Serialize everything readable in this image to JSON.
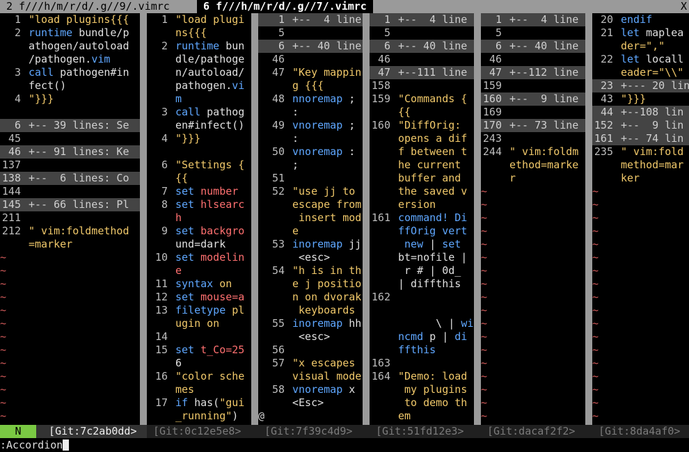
{
  "tabs": [
    {
      "label": " 2 f///h/m/r/d/.g//9/.vimrc ",
      "active": false
    },
    {
      "label": " 6 f///h/m/r/d/.g//7/.vimrc ",
      "active": true
    }
  ],
  "tab_close": "X",
  "panes": [
    {
      "numw": 30,
      "rows": [
        {
          "n": "1",
          "t": "\"load plugins{{{",
          "c": "cmt"
        },
        {
          "n": "2",
          "t": "runtime bundle/p",
          "c": "rt"
        },
        {
          "n": "",
          "t": "athogen/autoload"
        },
        {
          "n": "",
          "t": "/pathogen.vim",
          "c": "vimext"
        },
        {
          "n": "3",
          "t": "call pathogen#in",
          "c": "call"
        },
        {
          "n": "",
          "t": "fect()"
        },
        {
          "n": "4",
          "t": "\"}}}",
          "c": "cmt"
        },
        {
          "n": "",
          "t": ""
        },
        {
          "n": "6",
          "t": "+-- 39 lines: Se",
          "fold": true
        },
        {
          "n": "45",
          "t": ""
        },
        {
          "n": "46",
          "t": "+-- 91 lines: Ke",
          "fold": true
        },
        {
          "n": "137",
          "t": ""
        },
        {
          "n": "138",
          "t": "+--  6 lines: Co",
          "fold": true
        },
        {
          "n": "144",
          "t": ""
        },
        {
          "n": "145",
          "t": "+-- 66 lines: Pl",
          "fold": true
        },
        {
          "n": "211",
          "t": ""
        },
        {
          "n": "212",
          "t": "\" vim:foldmethod",
          "c": "cmt"
        },
        {
          "n": "",
          "t": "=marker",
          "c": "cmt"
        },
        {
          "n": "~",
          "tilde": true
        },
        {
          "n": "~",
          "tilde": true
        },
        {
          "n": "~",
          "tilde": true
        },
        {
          "n": "~",
          "tilde": true
        },
        {
          "n": "~",
          "tilde": true
        },
        {
          "n": "~",
          "tilde": true
        },
        {
          "n": "~",
          "tilde": true
        },
        {
          "n": "~",
          "tilde": true
        },
        {
          "n": "~",
          "tilde": true
        },
        {
          "n": "~",
          "tilde": true
        },
        {
          "n": "~",
          "tilde": true
        },
        {
          "n": "~",
          "tilde": true
        },
        {
          "n": "~",
          "tilde": true
        }
      ]
    },
    {
      "numw": 30,
      "rows": [
        {
          "n": "1",
          "t": "\"load plugi",
          "c": "cmt"
        },
        {
          "n": "",
          "t": "ns{{{",
          "c": "cmt"
        },
        {
          "n": "2",
          "t": "runtime bun",
          "c": "rt"
        },
        {
          "n": "",
          "t": "dle/pathoge"
        },
        {
          "n": "",
          "t": "n/autoload/"
        },
        {
          "n": "",
          "t": "pathogen.vi",
          "c": "vimext"
        },
        {
          "n": "",
          "t": "m",
          "c": "kw"
        },
        {
          "n": "3",
          "t": "call pathog",
          "c": "call"
        },
        {
          "n": "",
          "t": "en#infect()"
        },
        {
          "n": "4",
          "t": "\"}}}",
          "c": "cmt"
        },
        {
          "n": "",
          "t": ""
        },
        {
          "n": "6",
          "t": "\"Settings {",
          "c": "cmt"
        },
        {
          "n": "",
          "t": "{{",
          "c": "cmt"
        },
        {
          "n": "7",
          "t": "set number",
          "c": "setkw"
        },
        {
          "n": "8",
          "t": "set hlsearc",
          "c": "setkw"
        },
        {
          "n": "",
          "t": "h",
          "c": "setkw2"
        },
        {
          "n": "9",
          "t": "set backgro",
          "c": "setkw"
        },
        {
          "n": "",
          "t": "und=dark"
        },
        {
          "n": "10",
          "t": "set modelin",
          "c": "setkw"
        },
        {
          "n": "",
          "t": "e",
          "c": "setkw2"
        },
        {
          "n": "11",
          "t": "syntax on",
          "c": "syn"
        },
        {
          "n": "12",
          "t": "set mouse=a",
          "c": "setkw"
        },
        {
          "n": "13",
          "t": "filetype pl",
          "c": "ft"
        },
        {
          "n": "",
          "t": "ugin on",
          "c": "ft2"
        },
        {
          "n": "14",
          "t": ""
        },
        {
          "n": "15",
          "t": "set t_Co=25",
          "c": "setkw"
        },
        {
          "n": "",
          "t": "6"
        },
        {
          "n": "16",
          "t": "\"color sche",
          "c": "cmt"
        },
        {
          "n": "",
          "t": "mes",
          "c": "cmt"
        },
        {
          "n": "17",
          "t": "if has(\"gui",
          "c": "ifhas"
        },
        {
          "n": "",
          "t": "_running\")",
          "c": "str2"
        }
      ]
    },
    {
      "numw": 38,
      "rows": [
        {
          "n": "1",
          "t": "+--  4 line",
          "fold": true
        },
        {
          "n": "5",
          "t": ""
        },
        {
          "n": "6",
          "t": "+-- 40 line",
          "fold": true
        },
        {
          "n": "46",
          "t": ""
        },
        {
          "n": "47",
          "t": "\"Key mappin",
          "c": "cmt"
        },
        {
          "n": "",
          "t": "g {{{",
          "c": "cmt"
        },
        {
          "n": "48",
          "t": "nnoremap ;",
          "c": "map"
        },
        {
          "n": "",
          "t": ":"
        },
        {
          "n": "49",
          "t": "vnoremap ;",
          "c": "map"
        },
        {
          "n": "",
          "t": ":"
        },
        {
          "n": "50",
          "t": "vnoremap :",
          "c": "map"
        },
        {
          "n": "",
          "t": ";"
        },
        {
          "n": "51",
          "t": ""
        },
        {
          "n": "52",
          "t": "\"use jj to",
          "c": "cmt"
        },
        {
          "n": "",
          "t": "escape from",
          "c": "cmt"
        },
        {
          "n": "",
          "t": " insert mod",
          "c": "cmt"
        },
        {
          "n": "",
          "t": "e",
          "c": "cmt"
        },
        {
          "n": "53",
          "t": "inoremap jj",
          "c": "map"
        },
        {
          "n": "",
          "t": " <esc>"
        },
        {
          "n": "54",
          "t": "\"h is in th",
          "c": "cmt"
        },
        {
          "n": "",
          "t": "e j positio",
          "c": "cmt"
        },
        {
          "n": "",
          "t": "n on dvorak",
          "c": "cmt"
        },
        {
          "n": "",
          "t": " keyboards",
          "c": "cmt"
        },
        {
          "n": "55",
          "t": "inoremap hh",
          "c": "map"
        },
        {
          "n": "",
          "t": " <esc>"
        },
        {
          "n": "56",
          "t": ""
        },
        {
          "n": "57",
          "t": "\"x escapes",
          "c": "cmt"
        },
        {
          "n": "",
          "t": "visual mode",
          "c": "cmt"
        },
        {
          "n": "58",
          "t": "vnoremap x",
          "c": "map"
        },
        {
          "n": "",
          "t": "<Esc>"
        },
        {
          "n": "@",
          "at": true
        }
      ]
    },
    {
      "numw": 30,
      "rows": [
        {
          "n": "1",
          "t": "+--  4 line",
          "fold": true
        },
        {
          "n": "5",
          "t": ""
        },
        {
          "n": "6",
          "t": "+-- 40 line",
          "fold": true
        },
        {
          "n": "46",
          "t": ""
        },
        {
          "n": "47",
          "t": "+--111 line",
          "fold": true
        },
        {
          "n": "158",
          "t": ""
        },
        {
          "n": "159",
          "t": "\"Commands {",
          "c": "cmt"
        },
        {
          "n": "",
          "t": "{{",
          "c": "cmt"
        },
        {
          "n": "160",
          "t": "\"DiffOrig:",
          "c": "cmt"
        },
        {
          "n": "",
          "t": "opens a dif",
          "c": "cmt"
        },
        {
          "n": "",
          "t": "f between t",
          "c": "cmt"
        },
        {
          "n": "",
          "t": "he current",
          "c": "cmt"
        },
        {
          "n": "",
          "t": "buffer and",
          "c": "cmt"
        },
        {
          "n": "",
          "t": "the saved v",
          "c": "cmt"
        },
        {
          "n": "",
          "t": "ersion",
          "c": "cmt"
        },
        {
          "n": "161",
          "t": "command! Di",
          "c": "cmd"
        },
        {
          "n": "",
          "t": "ffOrig vert",
          "c": "cmd2"
        },
        {
          "n": "",
          "t": " new | set",
          "c": "cmd3"
        },
        {
          "n": "",
          "t": "bt=nofile |"
        },
        {
          "n": "",
          "t": " r # | 0d_"
        },
        {
          "n": "",
          "t": "| diffthis"
        },
        {
          "n": "162",
          "t": ""
        },
        {
          "n": "",
          "t": ""
        },
        {
          "n": "",
          "t": "      \\ | wi",
          "c": "cmd4"
        },
        {
          "n": "",
          "t": "ncmd p | di",
          "c": "cmd5"
        },
        {
          "n": "",
          "t": "ffthis",
          "c": "kw"
        },
        {
          "n": "163",
          "t": ""
        },
        {
          "n": "164",
          "t": "\"Demo: load",
          "c": "cmt"
        },
        {
          "n": "",
          "t": " my plugins",
          "c": "cmt"
        },
        {
          "n": "",
          "t": " to demo th",
          "c": "cmt"
        },
        {
          "n": "",
          "t": "em",
          "c": "cmt"
        },
        {
          "n": "@",
          "at": true
        }
      ]
    },
    {
      "numw": 30,
      "rows": [
        {
          "n": "1",
          "t": "+--  4 line",
          "fold": true
        },
        {
          "n": "5",
          "t": ""
        },
        {
          "n": "6",
          "t": "+-- 40 line",
          "fold": true
        },
        {
          "n": "46",
          "t": ""
        },
        {
          "n": "47",
          "t": "+--112 line",
          "fold": true
        },
        {
          "n": "159",
          "t": ""
        },
        {
          "n": "160",
          "t": "+--  9 line",
          "fold": true
        },
        {
          "n": "169",
          "t": ""
        },
        {
          "n": "170",
          "t": "+-- 73 line",
          "fold": true
        },
        {
          "n": "243",
          "t": ""
        },
        {
          "n": "244",
          "t": "\" vim:foldm",
          "c": "cmt"
        },
        {
          "n": "",
          "t": "ethod=marke",
          "c": "cmt"
        },
        {
          "n": "",
          "t": "r",
          "c": "cmt"
        },
        {
          "n": "~",
          "tilde": true
        },
        {
          "n": "~",
          "tilde": true
        },
        {
          "n": "~",
          "tilde": true
        },
        {
          "n": "~",
          "tilde": true
        },
        {
          "n": "~",
          "tilde": true
        },
        {
          "n": "~",
          "tilde": true
        },
        {
          "n": "~",
          "tilde": true
        },
        {
          "n": "~",
          "tilde": true
        },
        {
          "n": "~",
          "tilde": true
        },
        {
          "n": "~",
          "tilde": true
        },
        {
          "n": "~",
          "tilde": true
        },
        {
          "n": "~",
          "tilde": true
        },
        {
          "n": "~",
          "tilde": true
        },
        {
          "n": "~",
          "tilde": true
        },
        {
          "n": "~",
          "tilde": true
        },
        {
          "n": "~",
          "tilde": true
        },
        {
          "n": "~",
          "tilde": true
        },
        {
          "n": "~",
          "tilde": true
        }
      ]
    },
    {
      "numw": 30,
      "rows": [
        {
          "n": "20",
          "t": "endif",
          "c": "kw"
        },
        {
          "n": "21",
          "t": "let maplea",
          "c": "letk"
        },
        {
          "n": "",
          "t": "der=\",\"",
          "c": "str"
        },
        {
          "n": "22",
          "t": "let locall",
          "c": "letk"
        },
        {
          "n": "",
          "t": "eader=\"\\\\\"",
          "c": "str"
        },
        {
          "n": "23",
          "t": "+--- 20 lin",
          "fold": true
        },
        {
          "n": "43",
          "t": "\"}}}",
          "c": "cmt"
        },
        {
          "n": "44",
          "t": "+--108 lin",
          "fold": true
        },
        {
          "n": "152",
          "t": "+--  9 lin",
          "fold": true
        },
        {
          "n": "161",
          "t": "+-- 74 lin",
          "fold": true
        },
        {
          "n": "235",
          "t": "\" vim:fold",
          "c": "cmt"
        },
        {
          "n": "",
          "t": "method=mar",
          "c": "cmt"
        },
        {
          "n": "",
          "t": "ker",
          "c": "cmt"
        },
        {
          "n": "~",
          "tilde": true
        },
        {
          "n": "~",
          "tilde": true
        },
        {
          "n": "~",
          "tilde": true
        },
        {
          "n": "~",
          "tilde": true
        },
        {
          "n": "~",
          "tilde": true
        },
        {
          "n": "~",
          "tilde": true
        },
        {
          "n": "~",
          "tilde": true
        },
        {
          "n": "~",
          "tilde": true
        },
        {
          "n": "~",
          "tilde": true
        },
        {
          "n": "~",
          "tilde": true
        },
        {
          "n": "~",
          "tilde": true
        },
        {
          "n": "~",
          "tilde": true
        },
        {
          "n": "~",
          "tilde": true
        },
        {
          "n": "~",
          "tilde": true
        },
        {
          "n": "~",
          "tilde": true
        },
        {
          "n": "~",
          "tilde": true
        },
        {
          "n": "~",
          "tilde": true
        },
        {
          "n": "~",
          "tilde": true
        }
      ]
    }
  ],
  "statuslines": [
    {
      "mode": "N",
      "git": "[Git:7c2ab0dd>",
      "current": true
    },
    {
      "git": "[Git:0c12e5e8>",
      "current": false
    },
    {
      "git": "[Git:7f39c4d9>",
      "current": false
    },
    {
      "git": "[Git:51fd12e3>",
      "current": false
    },
    {
      "git": "[Git:dacaf2f2>",
      "current": false
    },
    {
      "git": "[Git:8da4af0>",
      "current": false
    }
  ],
  "command": ":Accordion",
  "colors": {
    "fold_bg": "#444444",
    "separator": "#9a9a9a",
    "tilde": "#d15a5a",
    "comment": "#f0c86a",
    "keyword": "#5fa7ff",
    "set_keyword": "#ff7070",
    "mode_badge": "#7ac943"
  }
}
